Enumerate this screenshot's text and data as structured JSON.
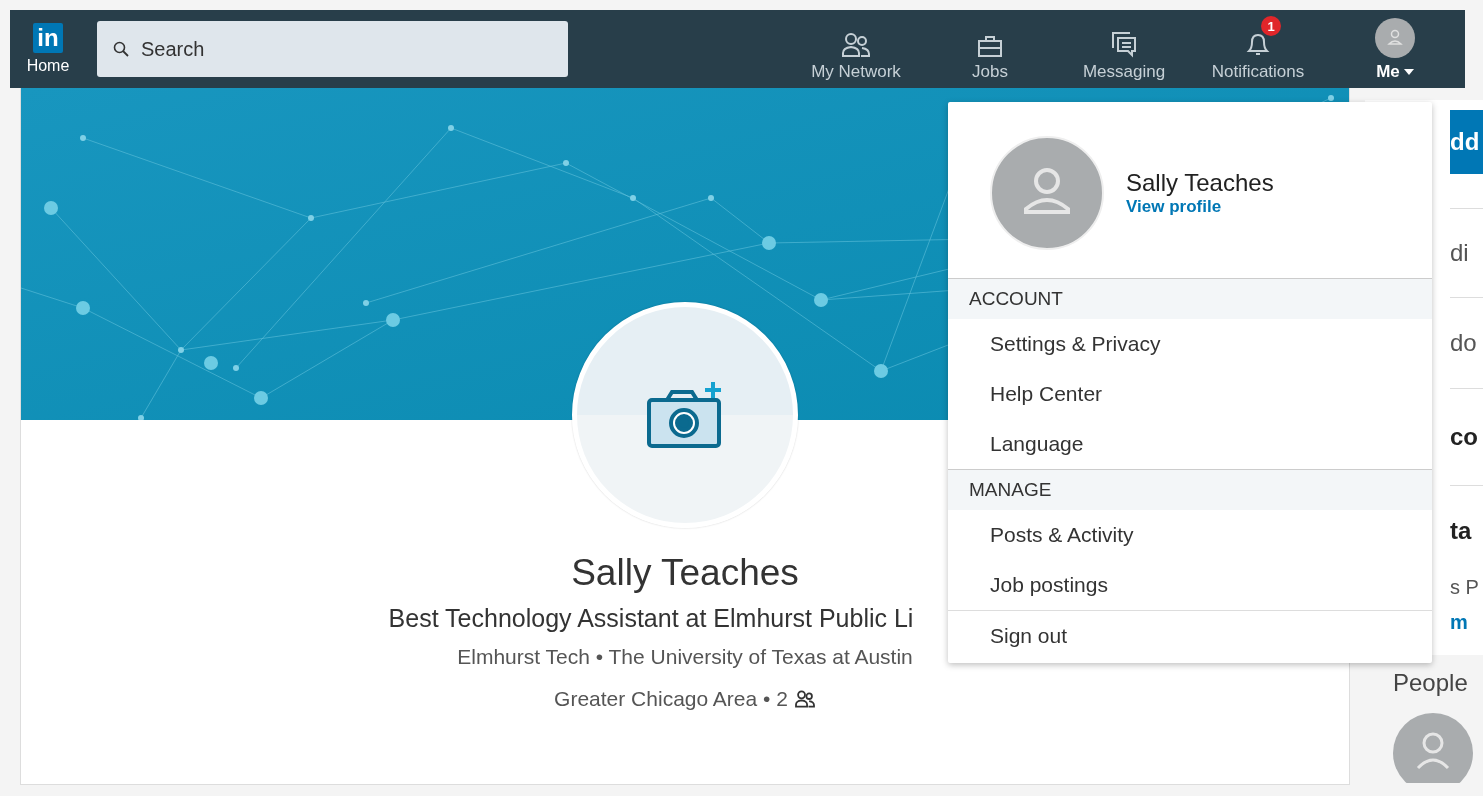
{
  "nav": {
    "logo": "in",
    "home": "Home",
    "search": {
      "placeholder": "Search"
    },
    "items": [
      {
        "label": "My Network",
        "kind": "network",
        "selected": false
      },
      {
        "label": "Jobs",
        "kind": "jobs",
        "selected": false
      },
      {
        "label": "Messaging",
        "kind": "messaging",
        "selected": false
      },
      {
        "label": "Notifications",
        "kind": "notifications",
        "badge": "1",
        "selected": false
      },
      {
        "label": "Me",
        "kind": "me",
        "selected": true
      }
    ]
  },
  "profile": {
    "name": "Sally Teaches",
    "headline": "Best Technology Assistant at Elmhurst Public Li",
    "education": "Elmhurst Tech • The University of Texas at Austin",
    "location": "Greater Chicago Area • 2"
  },
  "menu": {
    "name": "Sally Teaches",
    "link": "View profile",
    "sections": [
      {
        "title": "ACCOUNT",
        "items": [
          "Settings & Privacy",
          "Help Center",
          "Language"
        ]
      },
      {
        "title": "MANAGE",
        "items": [
          "Posts & Activity",
          "Job postings"
        ]
      }
    ],
    "sign_out": "Sign out"
  },
  "right_panel": [
    {
      "kind": "button",
      "text": "dd"
    },
    {
      "kind": "row",
      "text": "di"
    },
    {
      "kind": "row",
      "text": "do"
    },
    {
      "kind": "bold",
      "text": "co"
    },
    {
      "kind": "bold",
      "text": "ta"
    },
    {
      "kind": "text",
      "text": "s P"
    },
    {
      "kind": "link",
      "text": "m"
    },
    {
      "kind": "heading",
      "text": "People"
    }
  ]
}
